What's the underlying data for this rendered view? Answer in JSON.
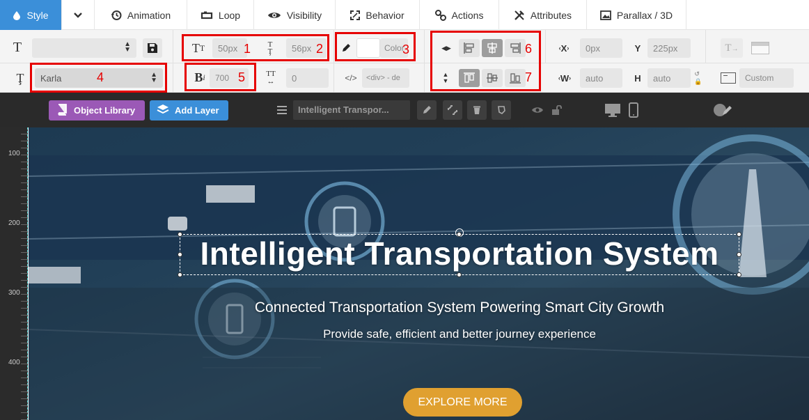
{
  "tabs": [
    {
      "label": "Style",
      "icon": "drop-icon"
    },
    {
      "label": "",
      "icon": "chevron-down-icon"
    },
    {
      "label": "Animation",
      "icon": "history-icon"
    },
    {
      "label": "Loop",
      "icon": "loop-icon"
    },
    {
      "label": "Visibility",
      "icon": "eye-icon"
    },
    {
      "label": "Behavior",
      "icon": "expand-icon"
    },
    {
      "label": "Actions",
      "icon": "link-icon"
    },
    {
      "label": "Attributes",
      "icon": "tools-icon"
    },
    {
      "label": "Parallax / 3D",
      "icon": "image-icon"
    }
  ],
  "row1": {
    "font_size": "50px",
    "line_height": "56px",
    "color_label": "Color",
    "x_label": "X",
    "x_value": "0px",
    "y_label": "Y",
    "y_value": "225px"
  },
  "row2": {
    "font_family": "Karla",
    "font_weight": "700",
    "letter_spacing": "0",
    "tag": "<div> - de",
    "w_label": "W",
    "w_value": "auto",
    "h_label": "H",
    "h_value": "auto",
    "custom": "Custom"
  },
  "annotations": [
    "1",
    "2",
    "3",
    "4",
    "5",
    "6",
    "7"
  ],
  "toolbar": {
    "object_library": "Object Library",
    "add_layer": "Add Layer",
    "layer_name": "Intelligent Transpor..."
  },
  "ruler": {
    "ticks": [
      "100",
      "200",
      "300",
      "400"
    ]
  },
  "slide": {
    "title": "Intelligent Transportation System",
    "subtitle": "Connected Transportation System Powering Smart City Growth",
    "tagline": "Provide safe, efficient and better journey experience",
    "cta": "EXPLORE MORE"
  },
  "colors": {
    "accent": "#3b8fd9",
    "library": "#9b59b6",
    "cta": "#e0a030",
    "annotation": "#e60000"
  }
}
